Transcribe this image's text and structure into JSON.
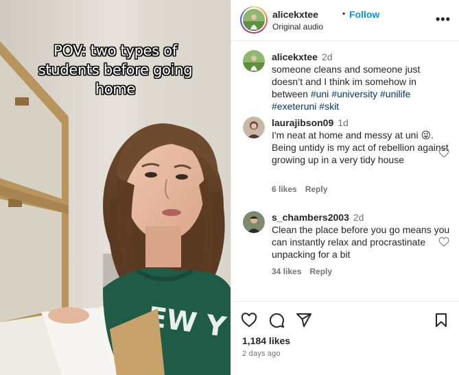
{
  "video": {
    "overlay_lines": [
      "POV: two types of",
      "students before going",
      "home"
    ],
    "sweater_text": "EW Y"
  },
  "post": {
    "username": "alicekxtee",
    "separator": "•",
    "follow_label": "Follow",
    "audio": "Original audio",
    "more_label": "•••"
  },
  "caption": {
    "username": "alicekxtee",
    "time": "2d",
    "text": "someone cleans and someone just doesn’t and I think im somehow in between ",
    "hashtags": [
      "#uni",
      "#university",
      "#unilife",
      "#exeteruni",
      "#skit"
    ]
  },
  "comments": [
    {
      "username": "laurajibson09",
      "time": "1d",
      "text_before": "I'm neat at home and messy at uni ",
      "emoji": "😜",
      "text_after": ". Being untidy is my act of rebellion against growing up in a very tidy house",
      "likes": "6 likes",
      "reply": "Reply"
    },
    {
      "username": "s_chambers2003",
      "time": "2d",
      "text": "Clean the place before you go means you can instantly relax and procrastinate unpacking for a bit",
      "likes": "34 likes",
      "reply": "Reply"
    }
  ],
  "footer": {
    "likes": "1,184 likes",
    "ago": "2 days ago"
  },
  "icons": {
    "like": "heart-icon",
    "comment": "comment-icon",
    "share": "share-icon",
    "save": "bookmark-icon",
    "more": "more-icon"
  },
  "colors": {
    "link": "#0095f6",
    "hashtag": "#00376b",
    "muted": "#737373",
    "sweater": "#1f5b46"
  }
}
